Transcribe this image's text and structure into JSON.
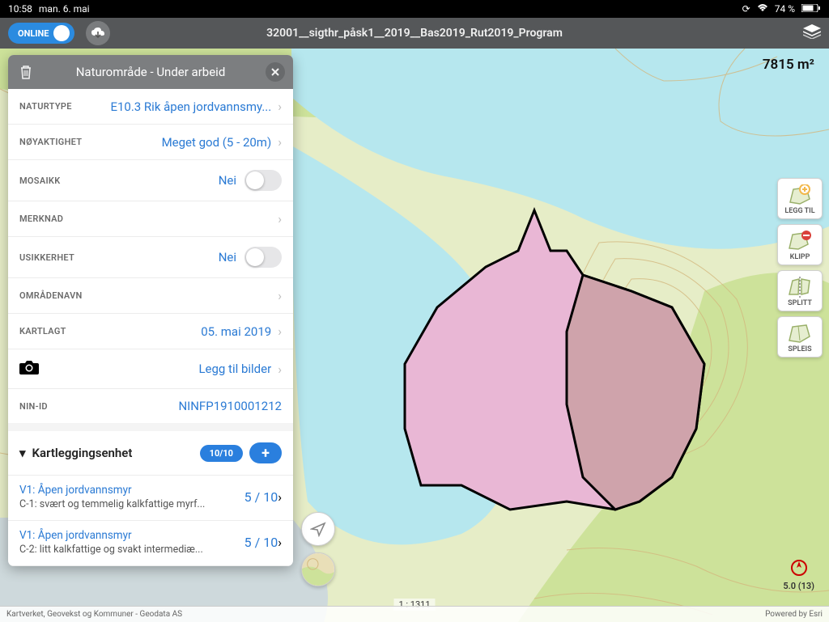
{
  "status": {
    "time": "10:58",
    "date": "man. 6. mai",
    "battery": "74 %",
    "wifi": "wifi-icon",
    "sync": "sync-icon"
  },
  "topbar": {
    "online_label": "ONLINE",
    "project_title": "32001__sigthr_påsk1__2019__Bas2019_Rut2019_Program"
  },
  "map": {
    "area_label": "7815 m²",
    "scale": "1 : 1311",
    "accuracy": "5.0 (13)",
    "attribution_left": "Kartverket, Geovekst og Kommuner - Geodata AS",
    "attribution_right": "Powered by Esri"
  },
  "tools": {
    "leggtil": "LEGG TIL",
    "klipp": "KLIPP",
    "splitt": "SPLITT",
    "spleis": "SPLEIS"
  },
  "panel": {
    "title": "Naturområde - Under arbeid",
    "rows": {
      "naturtype": {
        "label": "NATURTYPE",
        "value": "E10.3 Rik åpen jordvannsmy..."
      },
      "noyaktighet": {
        "label": "NØYAKTIGHET",
        "value": "Meget god (5 - 20m)"
      },
      "mosaikk": {
        "label": "MOSAIKK",
        "value": "Nei"
      },
      "merknad": {
        "label": "MERKNAD",
        "value": ""
      },
      "usikkerhet": {
        "label": "USIKKERHET",
        "value": "Nei"
      },
      "omradenavn": {
        "label": "OMRÅDENAVN",
        "value": ""
      },
      "kartlagt": {
        "label": "KARTLAGT",
        "value": "05. mai 2019"
      },
      "bilder_label": "Legg til bilder",
      "ninid": {
        "label": "NIN-ID",
        "value": "NINFP1910001212"
      }
    },
    "section": {
      "title": "Kartleggingsenhet",
      "count": "10/10"
    },
    "units": [
      {
        "title": "V1: Åpen jordvannsmyr",
        "sub": "C-1: svært og temmelig kalkfattige myrf...",
        "score": "5 / 10"
      },
      {
        "title": "V1: Åpen jordvannsmyr",
        "sub": "C-2: litt kalkfattige og svakt intermediæ...",
        "score": "5 / 10"
      }
    ]
  }
}
